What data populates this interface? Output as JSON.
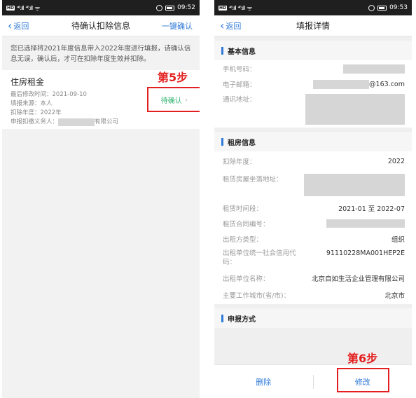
{
  "status_bar": {
    "hd": "HD",
    "sig1": "⁴⁶.ıll",
    "sig2": "⁴⁶.ıll",
    "wifi": "ᯤ",
    "time_left": "09:52",
    "time_right": "09:53"
  },
  "left": {
    "nav": {
      "back": "返回",
      "title": "待确认扣除信息",
      "action": "一键确认"
    },
    "notice": "您已选择将2021年度信息带入2022年度进行填报，请确认信息无误，确认后，才可在扣除年度生效并扣除。",
    "card": {
      "title": "住房租金",
      "rows": [
        "最后修改时间：2021-09-10",
        "填报来源：本人",
        "扣除年度：2022年"
      ],
      "withholder_label": "申报扣缴义务人：",
      "withholder_suffix": "有限公司",
      "status": "待确认"
    },
    "step": "第5步"
  },
  "right": {
    "nav": {
      "back": "返回",
      "title": "填报详情"
    },
    "basic": {
      "title": "基本信息",
      "phone_label": "手机号码：",
      "email_label": "电子邮箱：",
      "email_suffix": "@163.com",
      "address_label": "通讯地址："
    },
    "rental": {
      "title": "租房信息",
      "year_label": "扣除年度：",
      "year_value": "2022",
      "location_label": "租赁房屋坐落地址：",
      "period_label": "租赁时间段：",
      "period_value": "2021-01 至 2022-07",
      "contract_label": "租赁合同编号：",
      "lessor_type_label": "出租方类型：",
      "lessor_type_value": "组织",
      "credit_code_label": "出租单位统一社会信用代码：",
      "credit_code_value": "91110228MA001HEP2E",
      "lessor_name_label": "出租单位名称：",
      "lessor_name_value": "北京自如生活企业管理有限公司",
      "city_label": "主要工作城市(省/市)：",
      "city_value": "北京市"
    },
    "method": {
      "title": "申报方式"
    },
    "footer": {
      "delete": "删除",
      "edit": "修改"
    },
    "step": "第6步"
  },
  "colors": {
    "accent": "#2f7ad9",
    "annotation": "#e3201f",
    "pending": "#2fb36e"
  },
  "icons": {
    "back": "chevron-left-icon",
    "status_chevron": "chevron-right-icon",
    "section_marker": "section-bar-icon"
  }
}
